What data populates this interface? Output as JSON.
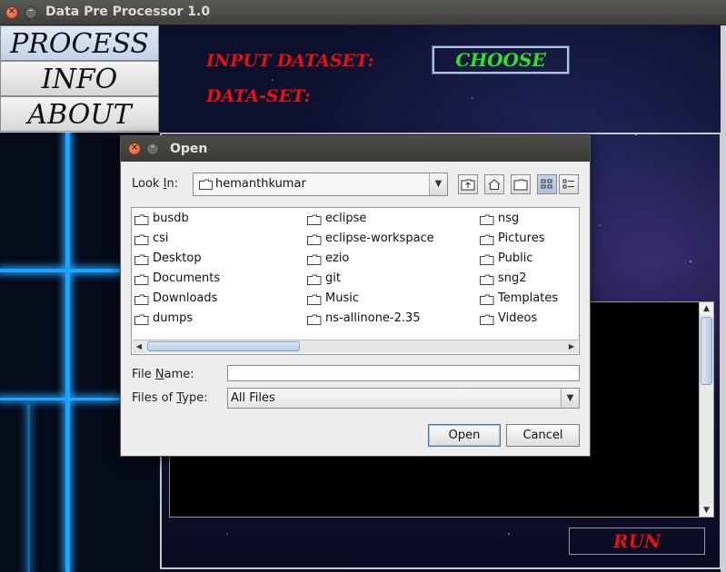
{
  "window": {
    "title": "Data Pre Processor 1.0",
    "close_icon": "close-icon",
    "minimize_icon": "minimize-icon"
  },
  "menu": {
    "items": [
      {
        "label": "PROCESS",
        "active": true
      },
      {
        "label": "INFO",
        "active": false
      },
      {
        "label": "ABOUT",
        "active": false
      }
    ]
  },
  "main": {
    "input_dataset_label": "INPUT DATASET:",
    "dataset_label": "DATA-SET:",
    "choose_label": "CHOOSE",
    "run_label": "RUN"
  },
  "colors": {
    "label_red": "#e81010",
    "choose_green": "#2ee02e",
    "grid_blue": "#1aa7ff"
  },
  "dialog": {
    "title": "Open",
    "look_in_label_pre": "Look ",
    "look_in_label_key": "I",
    "look_in_label_post": "n:",
    "look_in_value": "hemanthkumar",
    "toolbar_icons": [
      "up-folder-icon",
      "home-icon",
      "new-folder-icon",
      "list-view-icon",
      "details-view-icon"
    ],
    "files": {
      "col1": [
        "busdb",
        "csi",
        "Desktop",
        "Documents",
        "Downloads",
        "dumps"
      ],
      "col2": [
        "eclipse",
        "eclipse-workspace",
        "ezio",
        "git",
        "Music",
        "ns-allinone-2.35"
      ],
      "col3": [
        "nsg",
        "Pictures",
        "Public",
        "sng2",
        "Templates",
        "Videos"
      ]
    },
    "file_name_label_pre": "File ",
    "file_name_label_key": "N",
    "file_name_label_post": "ame:",
    "file_name_value": "",
    "file_type_label_pre": "Files of ",
    "file_type_label_key": "T",
    "file_type_label_post": "ype:",
    "file_type_value": "All Files",
    "open_label": "Open",
    "cancel_label": "Cancel"
  }
}
